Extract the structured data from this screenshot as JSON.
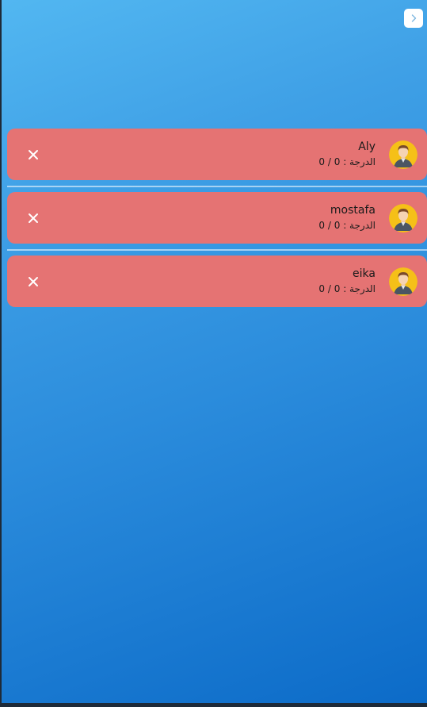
{
  "header": {
    "next_icon": "chevron-right-icon"
  },
  "players": [
    {
      "name": "Aly",
      "score_label": "الدرجة :",
      "score_value": "0 / 0",
      "avatar_icon": "user-avatar-icon",
      "remove_icon": "close-icon"
    },
    {
      "name": "mostafa",
      "score_label": "الدرجة :",
      "score_value": "0 / 0",
      "avatar_icon": "user-avatar-icon",
      "remove_icon": "close-icon"
    },
    {
      "name": "eika",
      "score_label": "الدرجة :",
      "score_value": "0 / 0",
      "avatar_icon": "user-avatar-icon",
      "remove_icon": "close-icon"
    }
  ],
  "colors": {
    "card": "#e57373",
    "background_top": "#52b7f1",
    "background_bottom": "#0c6bc8",
    "avatar_bg": "#f5c018"
  }
}
